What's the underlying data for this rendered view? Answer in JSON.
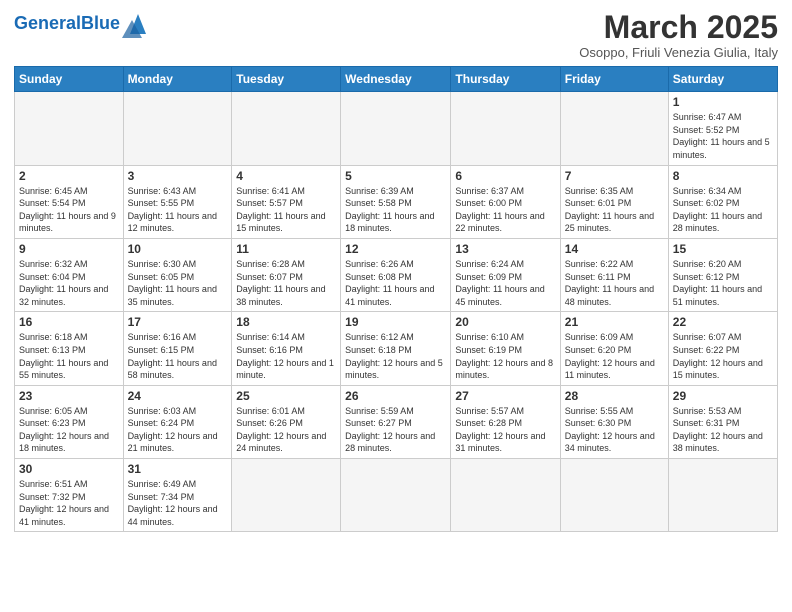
{
  "logo": {
    "text_general": "General",
    "text_blue": "Blue"
  },
  "header": {
    "month_year": "March 2025",
    "location": "Osoppo, Friuli Venezia Giulia, Italy"
  },
  "weekdays": [
    "Sunday",
    "Monday",
    "Tuesday",
    "Wednesday",
    "Thursday",
    "Friday",
    "Saturday"
  ],
  "weeks": [
    [
      {
        "day": "",
        "info": ""
      },
      {
        "day": "",
        "info": ""
      },
      {
        "day": "",
        "info": ""
      },
      {
        "day": "",
        "info": ""
      },
      {
        "day": "",
        "info": ""
      },
      {
        "day": "",
        "info": ""
      },
      {
        "day": "1",
        "info": "Sunrise: 6:47 AM\nSunset: 5:52 PM\nDaylight: 11 hours and 5 minutes."
      }
    ],
    [
      {
        "day": "2",
        "info": "Sunrise: 6:45 AM\nSunset: 5:54 PM\nDaylight: 11 hours and 9 minutes."
      },
      {
        "day": "3",
        "info": "Sunrise: 6:43 AM\nSunset: 5:55 PM\nDaylight: 11 hours and 12 minutes."
      },
      {
        "day": "4",
        "info": "Sunrise: 6:41 AM\nSunset: 5:57 PM\nDaylight: 11 hours and 15 minutes."
      },
      {
        "day": "5",
        "info": "Sunrise: 6:39 AM\nSunset: 5:58 PM\nDaylight: 11 hours and 18 minutes."
      },
      {
        "day": "6",
        "info": "Sunrise: 6:37 AM\nSunset: 6:00 PM\nDaylight: 11 hours and 22 minutes."
      },
      {
        "day": "7",
        "info": "Sunrise: 6:35 AM\nSunset: 6:01 PM\nDaylight: 11 hours and 25 minutes."
      },
      {
        "day": "8",
        "info": "Sunrise: 6:34 AM\nSunset: 6:02 PM\nDaylight: 11 hours and 28 minutes."
      }
    ],
    [
      {
        "day": "9",
        "info": "Sunrise: 6:32 AM\nSunset: 6:04 PM\nDaylight: 11 hours and 32 minutes."
      },
      {
        "day": "10",
        "info": "Sunrise: 6:30 AM\nSunset: 6:05 PM\nDaylight: 11 hours and 35 minutes."
      },
      {
        "day": "11",
        "info": "Sunrise: 6:28 AM\nSunset: 6:07 PM\nDaylight: 11 hours and 38 minutes."
      },
      {
        "day": "12",
        "info": "Sunrise: 6:26 AM\nSunset: 6:08 PM\nDaylight: 11 hours and 41 minutes."
      },
      {
        "day": "13",
        "info": "Sunrise: 6:24 AM\nSunset: 6:09 PM\nDaylight: 11 hours and 45 minutes."
      },
      {
        "day": "14",
        "info": "Sunrise: 6:22 AM\nSunset: 6:11 PM\nDaylight: 11 hours and 48 minutes."
      },
      {
        "day": "15",
        "info": "Sunrise: 6:20 AM\nSunset: 6:12 PM\nDaylight: 11 hours and 51 minutes."
      }
    ],
    [
      {
        "day": "16",
        "info": "Sunrise: 6:18 AM\nSunset: 6:13 PM\nDaylight: 11 hours and 55 minutes."
      },
      {
        "day": "17",
        "info": "Sunrise: 6:16 AM\nSunset: 6:15 PM\nDaylight: 11 hours and 58 minutes."
      },
      {
        "day": "18",
        "info": "Sunrise: 6:14 AM\nSunset: 6:16 PM\nDaylight: 12 hours and 1 minute."
      },
      {
        "day": "19",
        "info": "Sunrise: 6:12 AM\nSunset: 6:18 PM\nDaylight: 12 hours and 5 minutes."
      },
      {
        "day": "20",
        "info": "Sunrise: 6:10 AM\nSunset: 6:19 PM\nDaylight: 12 hours and 8 minutes."
      },
      {
        "day": "21",
        "info": "Sunrise: 6:09 AM\nSunset: 6:20 PM\nDaylight: 12 hours and 11 minutes."
      },
      {
        "day": "22",
        "info": "Sunrise: 6:07 AM\nSunset: 6:22 PM\nDaylight: 12 hours and 15 minutes."
      }
    ],
    [
      {
        "day": "23",
        "info": "Sunrise: 6:05 AM\nSunset: 6:23 PM\nDaylight: 12 hours and 18 minutes."
      },
      {
        "day": "24",
        "info": "Sunrise: 6:03 AM\nSunset: 6:24 PM\nDaylight: 12 hours and 21 minutes."
      },
      {
        "day": "25",
        "info": "Sunrise: 6:01 AM\nSunset: 6:26 PM\nDaylight: 12 hours and 24 minutes."
      },
      {
        "day": "26",
        "info": "Sunrise: 5:59 AM\nSunset: 6:27 PM\nDaylight: 12 hours and 28 minutes."
      },
      {
        "day": "27",
        "info": "Sunrise: 5:57 AM\nSunset: 6:28 PM\nDaylight: 12 hours and 31 minutes."
      },
      {
        "day": "28",
        "info": "Sunrise: 5:55 AM\nSunset: 6:30 PM\nDaylight: 12 hours and 34 minutes."
      },
      {
        "day": "29",
        "info": "Sunrise: 5:53 AM\nSunset: 6:31 PM\nDaylight: 12 hours and 38 minutes."
      }
    ],
    [
      {
        "day": "30",
        "info": "Sunrise: 6:51 AM\nSunset: 7:32 PM\nDaylight: 12 hours and 41 minutes."
      },
      {
        "day": "31",
        "info": "Sunrise: 6:49 AM\nSunset: 7:34 PM\nDaylight: 12 hours and 44 minutes."
      },
      {
        "day": "",
        "info": ""
      },
      {
        "day": "",
        "info": ""
      },
      {
        "day": "",
        "info": ""
      },
      {
        "day": "",
        "info": ""
      },
      {
        "day": "",
        "info": ""
      }
    ]
  ]
}
